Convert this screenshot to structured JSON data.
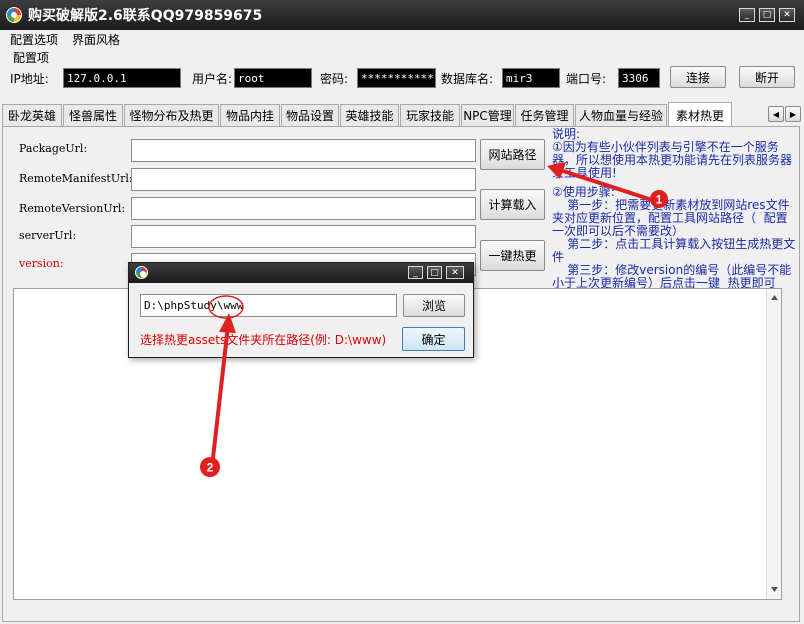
{
  "window": {
    "title": "购买破解版2.6联系QQ979859675",
    "controls": {
      "minimize": "_",
      "maximize": "□",
      "close": "✕"
    }
  },
  "menu": {
    "items": [
      "配置选项",
      "界面风格"
    ]
  },
  "config": {
    "group_label": "配置项",
    "ip_label": "IP地址:",
    "ip_value": "127.0.0.1",
    "user_label": "用户名:",
    "user_value": "root",
    "password_label": "密码:",
    "password_value": "*************",
    "db_label": "数据库名:",
    "db_value": "mir3",
    "port_label": "端口号:",
    "port_value": "3306",
    "connect_label": "连接",
    "disconnect_label": "断开"
  },
  "tabs": [
    "卧龙英雄",
    "怪兽属性",
    "怪物分布及热更",
    "物品内挂",
    "物品设置",
    "英雄技能",
    "玩家技能",
    "NPC管理",
    "任务管理",
    "人物血量与经验",
    "素材热更"
  ],
  "tab_scroll": {
    "left": "◀",
    "right": "▶"
  },
  "form": {
    "package_url_label": "PackageUrl:",
    "remote_manifest_label": "RemoteManifestUrl:",
    "remote_version_label": "RemoteVersionUrl:",
    "server_url_label": "serverUrl:",
    "version_label": "version:",
    "site_path_button": "网站路径",
    "calc_load_button": "计算载入",
    "hot_update_button": "一键热更"
  },
  "help": {
    "title": "说明:",
    "lines": [
      "①因为有些小伙伴列表与引擎不在一个服务",
      "器，所以想使用本热更功能请先在列表服务器",
      "录工具使用!",
      "",
      "②使用步骤:",
      "    第一步：把需要更新素材放到网站res文件",
      "夹对应更新位置，配置工具网站路径（  配置",
      "一次即可以后不需要改）",
      "    第二步：点击工具计算载入按钮生成热更文",
      "件",
      "    第三步：修改version的编号（此编号不能",
      "小于上次更新编号）后点击一键  热更即可"
    ]
  },
  "dialog": {
    "path_value": "D:\\phpStudy\\www",
    "browse_label": "浏览",
    "hint": "选择热更assets文件夹所在路径(例: D:\\www)",
    "ok_label": "确定"
  },
  "annotations": {
    "marker1": "1",
    "marker2": "2"
  },
  "colors": {
    "title_bar": "#2b2b2b",
    "help_text": "#1a2aa8",
    "hint_text": "#e00000",
    "annotation": "#e02020"
  }
}
